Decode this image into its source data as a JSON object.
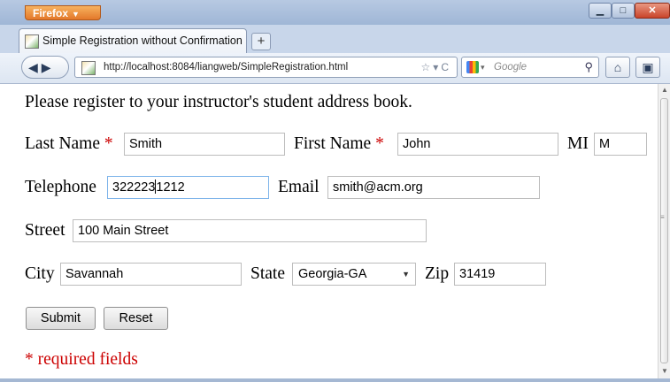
{
  "browser": {
    "app_button": "Firefox",
    "tab_title": "Simple Registration without Confirmation",
    "new_tab": "+",
    "url": "http://localhost:8084/liangweb/SimpleRegistration.html",
    "search_placeholder": "Google"
  },
  "form": {
    "intro": "Please register to your instructor's student address book.",
    "required_mark": "*",
    "last_name": {
      "label": "Last Name",
      "value": "Smith"
    },
    "first_name": {
      "label": "First Name",
      "value": "John"
    },
    "mi": {
      "label": "MI",
      "value": "M"
    },
    "telephone": {
      "label": "Telephone",
      "value_before_caret": "322223",
      "value_after_caret": "1212"
    },
    "email": {
      "label": "Email",
      "value": "smith@acm.org"
    },
    "street": {
      "label": "Street",
      "value": "100 Main Street"
    },
    "city": {
      "label": "City",
      "value": "Savannah"
    },
    "state": {
      "label": "State",
      "selected": "Georgia-GA"
    },
    "zip": {
      "label": "Zip",
      "value": "31419"
    },
    "submit_label": "Submit",
    "reset_label": "Reset",
    "required_note": "* required fields"
  },
  "icons": [
    "firefox-menu-icon",
    "favicon-icon",
    "back-icon",
    "forward-icon",
    "star-icon",
    "reload-icon",
    "google-icon",
    "search-icon",
    "home-icon",
    "bookmarks-icon"
  ]
}
